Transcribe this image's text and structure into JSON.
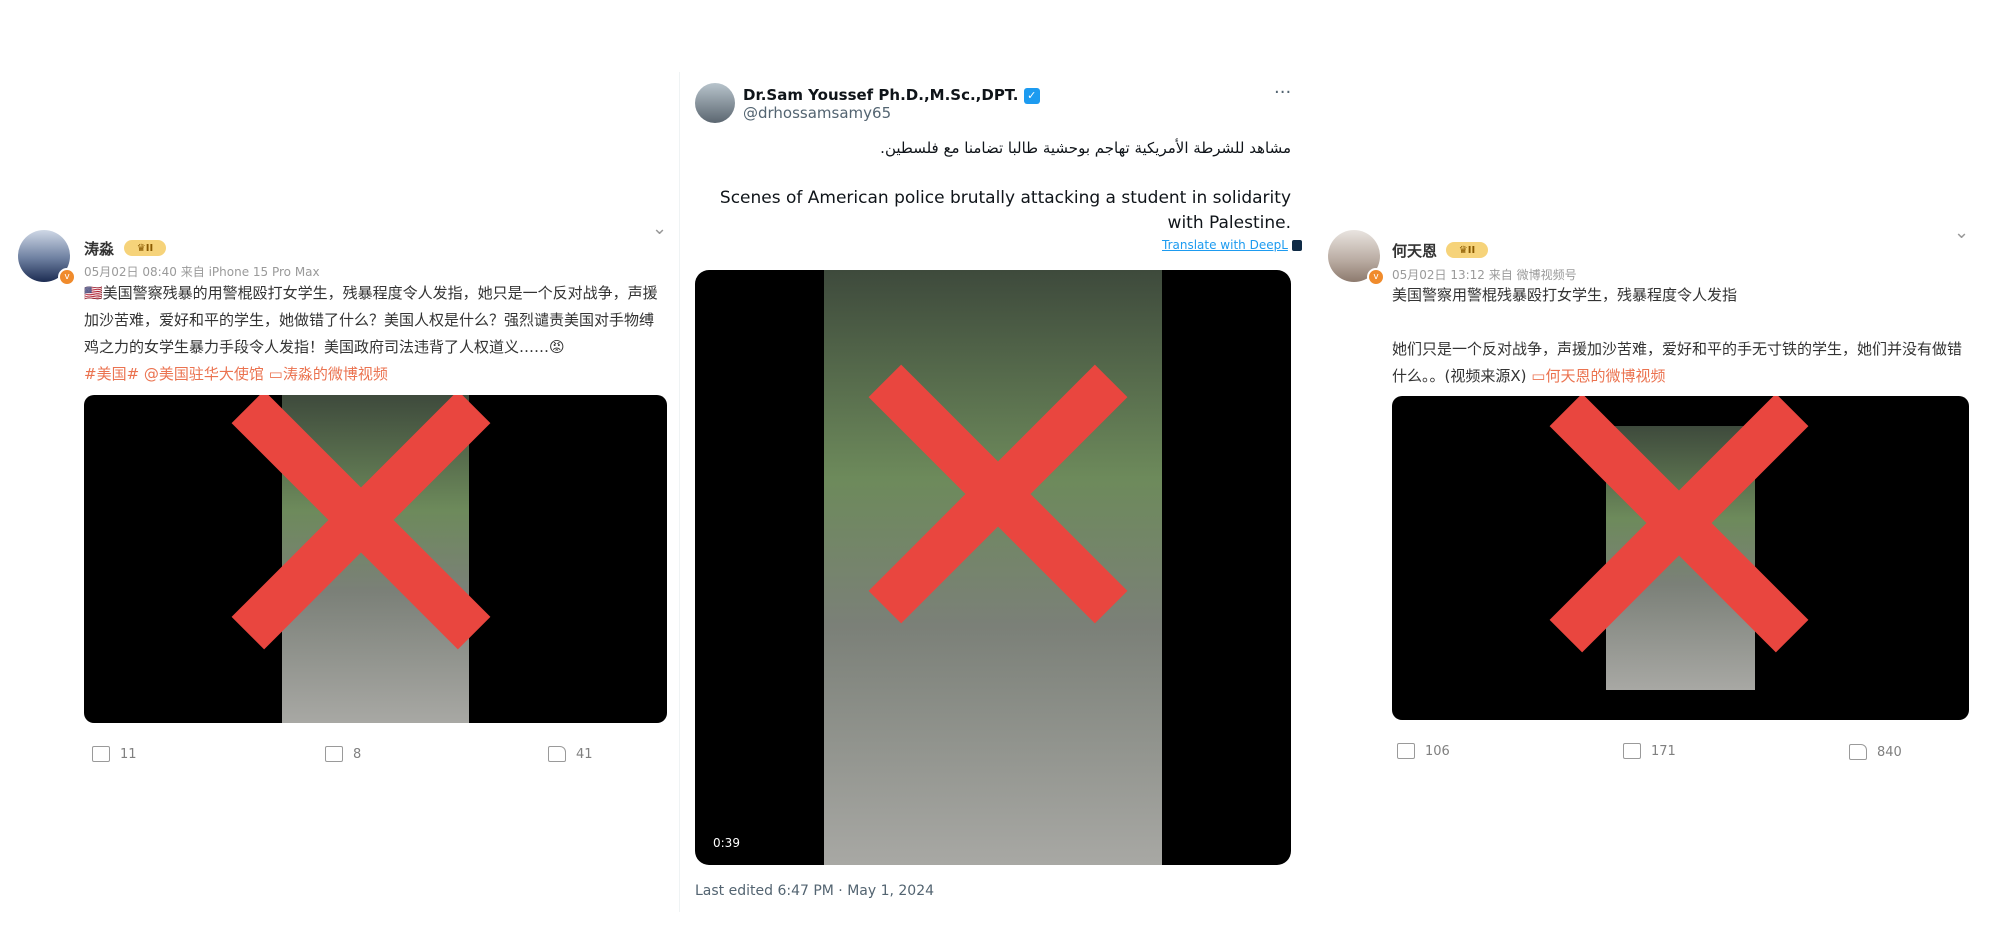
{
  "left_post": {
    "author": "涛淼",
    "badge_level": "II",
    "verified_mark": "v",
    "meta": "05月02日 08:40  来自 iPhone 15 Pro Max",
    "text": "🇺🇸美国警察残暴的用警棍殴打女学生，残暴程度令人发指，她只是一个反对战争，声援加沙苦难，爱好和平的学生，她做错了什么？美国人权是什么？强烈谴责美国对手物缚鸡之力的女学生暴力手段令人发指！美国政府司法违背了人权道义……😡",
    "tags": "#美国# @美国驻华大使馆 ▭涛淼的微博视频",
    "repost_count": "11",
    "comment_count": "8",
    "like_count": "41",
    "icons": [
      "share-icon",
      "comment-icon",
      "like-icon",
      "chevron-down-icon"
    ]
  },
  "center_post": {
    "author": "Dr.Sam Youssef Ph.D.,M.Sc.,DPT.",
    "handle": "@drhossamsamy65",
    "more": "···",
    "text_ar": "مشاهد للشرطة الأمريكية تهاجم بوحشية طالبا تضامنا مع فلسطين.",
    "text_en": "Scenes of American police brutally attacking a student in solidarity with Palestine.",
    "translate": "Translate with DeepL",
    "video_duration": "0:39",
    "last_edited": "Last edited 6:47 PM · May 1, 2024",
    "icons": [
      "verified-badge-icon",
      "more-icon",
      "deepl-icon"
    ]
  },
  "right_post": {
    "author": "何天恩",
    "badge_level": "II",
    "verified_mark": "v",
    "meta": "05月02日 13:12  来自 微博视频号",
    "text1": "美国警察用警棍残暴殴打女学生，残暴程度令人发指",
    "text2": "她们只是一个反对战争，声援加沙苦难，爱好和平的手无寸铁的学生，她们并没有做错什么。。(视频来源X)",
    "video_link": "▭何天恩的微博视频",
    "repost_count": "106",
    "comment_count": "171",
    "like_count": "840"
  },
  "colors": {
    "cross": "#e9463f",
    "weibo_link": "#eb7350",
    "x_blue": "#1d9bf0"
  }
}
